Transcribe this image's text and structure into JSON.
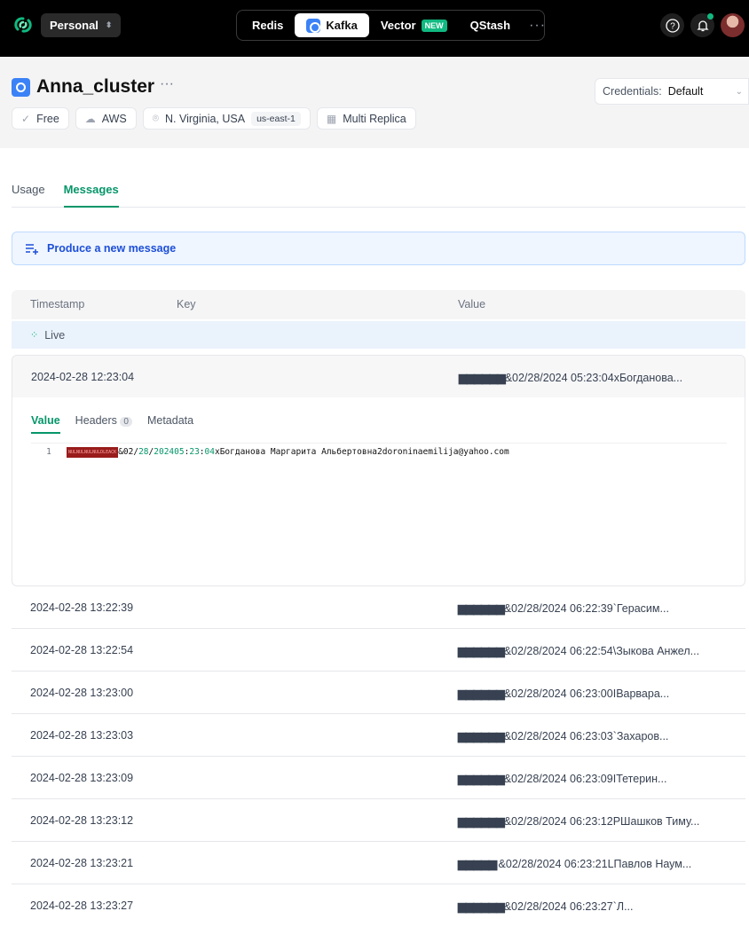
{
  "nav": {
    "team": "Personal",
    "products": [
      "Redis",
      "Kafka",
      "Vector",
      "QStash"
    ],
    "new_badge": "NEW",
    "more": "···"
  },
  "cluster": {
    "name": "Anna_cluster",
    "more": "···",
    "plan": "Free",
    "provider": "AWS",
    "location": "N. Virginia, USA",
    "region": "us-east-1",
    "replica": "Multi Replica",
    "credentials_label": "Credentials:",
    "credentials_value": "Default"
  },
  "tabs": [
    "Usage",
    "Messages"
  ],
  "produce_label": "Produce a new message",
  "table": {
    "headers": [
      "Timestamp",
      "Key",
      "Value"
    ],
    "live_label": "Live",
    "expanded": {
      "timestamp": "2024-02-28 12:23:04",
      "value_prefix": "▆▆▆▆▆▆",
      "value": "&02/28/2024 05:23:04хБогданова...",
      "subtabs": [
        "Value",
        "Headers",
        "Metadata"
      ],
      "headers_count": "0",
      "line_number": "1",
      "ctrl": "NULNULNULNULDLEACK",
      "code_pre": "&02/",
      "code_n1": "28",
      "code_s1": "/",
      "code_n2": "2024",
      "code_s2": " ",
      "code_n3": "05",
      "code_s3": ":",
      "code_n4": "23",
      "code_s4": ":",
      "code_n5": "04",
      "code_tail": "хБогданова Маргарита Альбертовна2doroninaemilija@yahoo.com"
    },
    "rows": [
      {
        "timestamp": "2024-02-28 13:22:39",
        "prefix": "▆▆▆▆▆▆",
        "value": "&02/28/2024 06:22:39`Герасим..."
      },
      {
        "timestamp": "2024-02-28 13:22:54",
        "prefix": "▆▆▆▆▆▆",
        "value": "&02/28/2024 06:22:54\\Зыкова Анжел..."
      },
      {
        "timestamp": "2024-02-28 13:23:00",
        "prefix": "▆▆▆▆▆▆",
        "value": "&02/28/2024 06:23:00IВарвара..."
      },
      {
        "timestamp": "2024-02-28 13:23:03",
        "prefix": "▆▆▆▆▆▆",
        "value": "&02/28/2024 06:23:03`Захаров..."
      },
      {
        "timestamp": "2024-02-28 13:23:09",
        "prefix": "▆▆▆▆▆▆",
        "value": "&02/28/2024 06:23:09IТетерин..."
      },
      {
        "timestamp": "2024-02-28 13:23:12",
        "prefix": "▆▆▆▆▆▆",
        "value": "&02/28/2024 06:23:12PШашков Тиму..."
      },
      {
        "timestamp": "2024-02-28 13:23:21",
        "prefix": "▆▆▆▆▆ ",
        "value": "&02/28/2024 06:23:21LПавлов Наум..."
      },
      {
        "timestamp": "2024-02-28 13:23:27",
        "prefix": "▆▆▆▆▆▆",
        "value": "&02/28/2024 06:23:27`Л..."
      }
    ]
  }
}
